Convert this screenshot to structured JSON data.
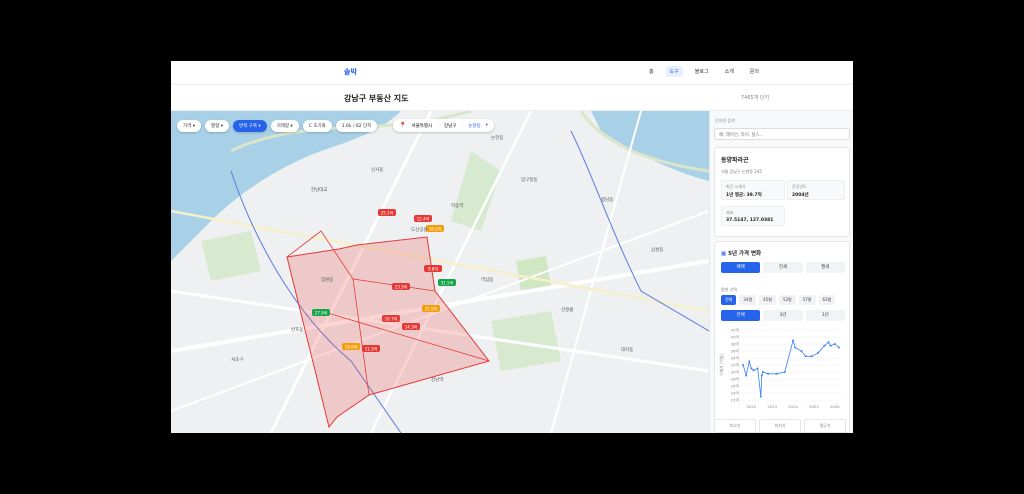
{
  "app": {
    "logo": "솔박"
  },
  "nav": {
    "items": [
      "홈",
      "도구",
      "블로그",
      "소개",
      "문의"
    ],
    "active": 1
  },
  "page": {
    "title": "강남구 부동산 지도",
    "tab_count": "7465개 단지"
  },
  "filters": [
    "가격 ▾",
    "평형 ▾",
    "면적 구축 ▾",
    "거래량 ▾",
    "C 초기화",
    "1.6k / 82 단지"
  ],
  "location": {
    "pin_icon": "map-pin-icon",
    "city": "서울특별시",
    "district": "강남구",
    "dong": "논현동"
  },
  "search": {
    "label": "단지명 검색",
    "placeholder": "예: 래미안, 자이, 힐스..."
  },
  "complex": {
    "name": "동양파라곤",
    "address": "서울 강남구 논현동 245",
    "fields": [
      {
        "label": "최근 시세가",
        "value": "1년 평균: 39.7억"
      },
      {
        "label": "준공년도",
        "value": "2004년"
      },
      {
        "label": "좌표",
        "value": "37.5147, 127.0381"
      }
    ]
  },
  "trend": {
    "title": "5년 가격 변화",
    "icon": "chart-icon",
    "deal_types": [
      "매매",
      "전세",
      "월세"
    ],
    "area_label": "평형 선택",
    "areas": [
      "전체",
      "34평",
      "45평",
      "52평",
      "57평",
      "63평"
    ],
    "periods": [
      "전체",
      "3년",
      "1년"
    ],
    "stats": [
      "최고가",
      "최저가",
      "평균가"
    ]
  },
  "chart_data": {
    "type": "line",
    "title": "",
    "xlabel": "",
    "ylabel": "거래가 (억원)",
    "x_ticks": [
      "2022",
      "2023",
      "2024",
      "2025",
      "2026"
    ],
    "y_ticks": [
      "42억",
      "40억",
      "38억",
      "36억",
      "34억",
      "32억",
      "30억",
      "28억",
      "26억",
      "24억",
      "22억"
    ],
    "ylim": [
      22,
      42
    ],
    "xlim": [
      2021.5,
      2026.3
    ],
    "x": [
      2021.6,
      2021.75,
      2021.9,
      2022.0,
      2022.1,
      2022.3,
      2022.45,
      2022.5,
      2022.55,
      2022.8,
      2023.2,
      2023.6,
      2024.0,
      2024.1,
      2024.4,
      2024.6,
      2024.9,
      2025.2,
      2025.5,
      2025.7,
      2025.8,
      2026.0,
      2026.2
    ],
    "y": [
      32,
      29,
      33,
      31,
      30.5,
      31,
      23,
      29,
      30,
      29.5,
      29.5,
      30,
      39,
      37,
      36,
      34.5,
      34.5,
      35.5,
      37.5,
      38.5,
      37.5,
      38,
      37
    ],
    "color": "#3b82f6",
    "grid": true
  },
  "map_labels": [
    "논현동",
    "신사동",
    "압구정동",
    "청담동",
    "역삼동",
    "강남역",
    "서초구",
    "반포동",
    "잠원동",
    "도산공원",
    "학동역",
    "선정릉",
    "삼성동",
    "한남대교",
    "대치동"
  ],
  "price_markers": [
    "12.4억",
    "18.2억",
    "25.1억",
    "9.8억",
    "31.5억",
    "16.7억",
    "21.0억",
    "14.3억",
    "27.9억",
    "11.5억",
    "19.6억",
    "23.3억"
  ]
}
